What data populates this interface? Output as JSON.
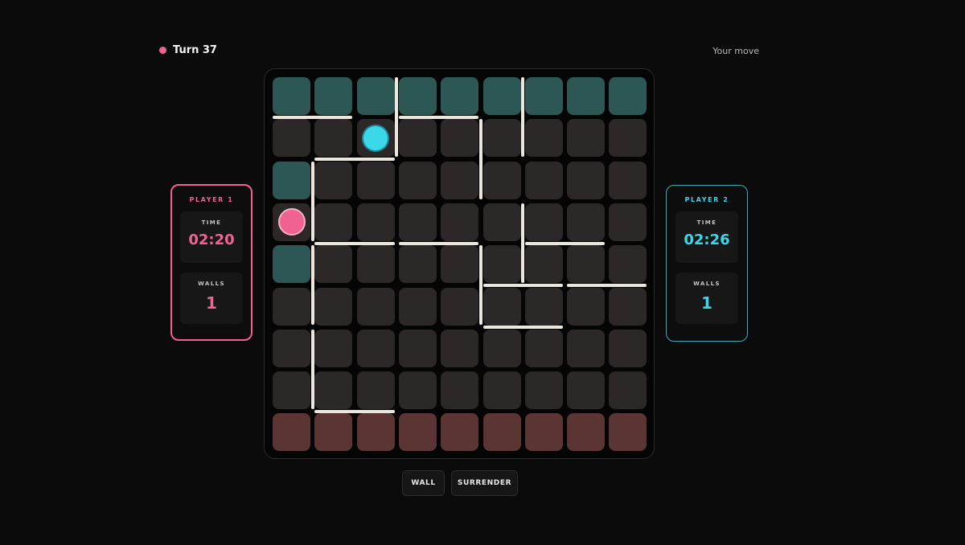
{
  "header": {
    "turn_label": "Turn 37",
    "status": "Your move"
  },
  "colors": {
    "player1": "#f06292",
    "player2": "#3ad8e9",
    "cell": "#2d2828",
    "top_goal": "#2c5754",
    "bottom_goal": "#5a3534",
    "wall": "#ece6dc"
  },
  "players": [
    {
      "title": "PLAYER 1",
      "time_label": "TIME",
      "time": "02:20",
      "walls_label": "WALLS",
      "walls": "1"
    },
    {
      "title": "PLAYER 2",
      "time_label": "TIME",
      "time": "02:26",
      "walls_label": "WALLS",
      "walls": "1"
    }
  ],
  "board": {
    "size": 9,
    "goal_cells": {
      "top": [
        [
          0,
          0
        ],
        [
          0,
          1
        ],
        [
          0,
          2
        ],
        [
          0,
          3
        ],
        [
          0,
          4
        ],
        [
          0,
          5
        ],
        [
          0,
          6
        ],
        [
          0,
          7
        ],
        [
          0,
          8
        ],
        [
          2,
          0
        ],
        [
          4,
          0
        ]
      ],
      "bottom": [
        [
          8,
          0
        ],
        [
          8,
          1
        ],
        [
          8,
          2
        ],
        [
          8,
          3
        ],
        [
          8,
          4
        ],
        [
          8,
          5
        ],
        [
          8,
          6
        ],
        [
          8,
          7
        ],
        [
          8,
          8
        ]
      ]
    },
    "pawns": [
      {
        "player": 1,
        "row": 3,
        "col": 0
      },
      {
        "player": 2,
        "row": 1,
        "col": 2
      }
    ],
    "walls": [
      {
        "orientation": "h",
        "row": 1,
        "col": 0
      },
      {
        "orientation": "h",
        "row": 1,
        "col": 3
      },
      {
        "orientation": "h",
        "row": 2,
        "col": 1
      },
      {
        "orientation": "h",
        "row": 4,
        "col": 1
      },
      {
        "orientation": "h",
        "row": 4,
        "col": 3
      },
      {
        "orientation": "h",
        "row": 4,
        "col": 6
      },
      {
        "orientation": "h",
        "row": 5,
        "col": 5
      },
      {
        "orientation": "h",
        "row": 5,
        "col": 7
      },
      {
        "orientation": "h",
        "row": 6,
        "col": 5
      },
      {
        "orientation": "h",
        "row": 8,
        "col": 1
      },
      {
        "orientation": "v",
        "row": 0,
        "col": 3
      },
      {
        "orientation": "v",
        "row": 0,
        "col": 6
      },
      {
        "orientation": "v",
        "row": 1,
        "col": 5
      },
      {
        "orientation": "v",
        "row": 2,
        "col": 1
      },
      {
        "orientation": "v",
        "row": 3,
        "col": 6
      },
      {
        "orientation": "v",
        "row": 4,
        "col": 1
      },
      {
        "orientation": "v",
        "row": 4,
        "col": 5
      },
      {
        "orientation": "v",
        "row": 6,
        "col": 1
      }
    ]
  },
  "controls": {
    "wall_label": "WALL",
    "surrender_label": "SURRENDER"
  }
}
